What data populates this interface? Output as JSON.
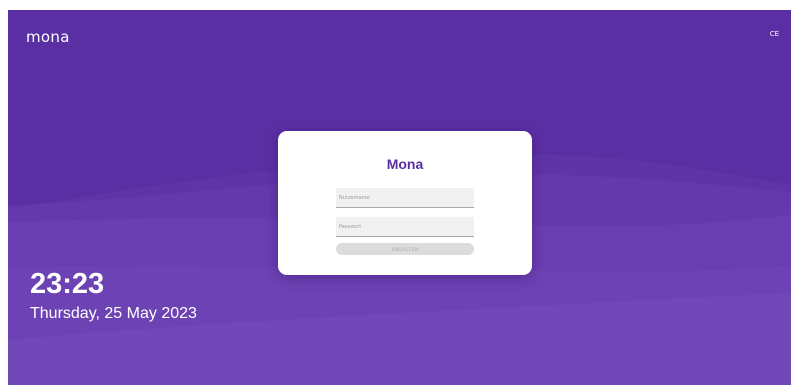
{
  "header": {
    "brand": "mona",
    "ce_mark": "CE"
  },
  "login": {
    "title": "Mona",
    "username_placeholder": "Nutzername",
    "username_value": "",
    "password_placeholder": "Passwort",
    "password_value": "",
    "submit_label": "EINLOGGEN"
  },
  "clock": {
    "time": "23:23",
    "date": "Thursday, 25 May 2023"
  },
  "colors": {
    "background": "#5a2fa3",
    "accent": "#5a2fa3",
    "card": "#ffffff",
    "button_disabled": "#dcdcdc"
  }
}
